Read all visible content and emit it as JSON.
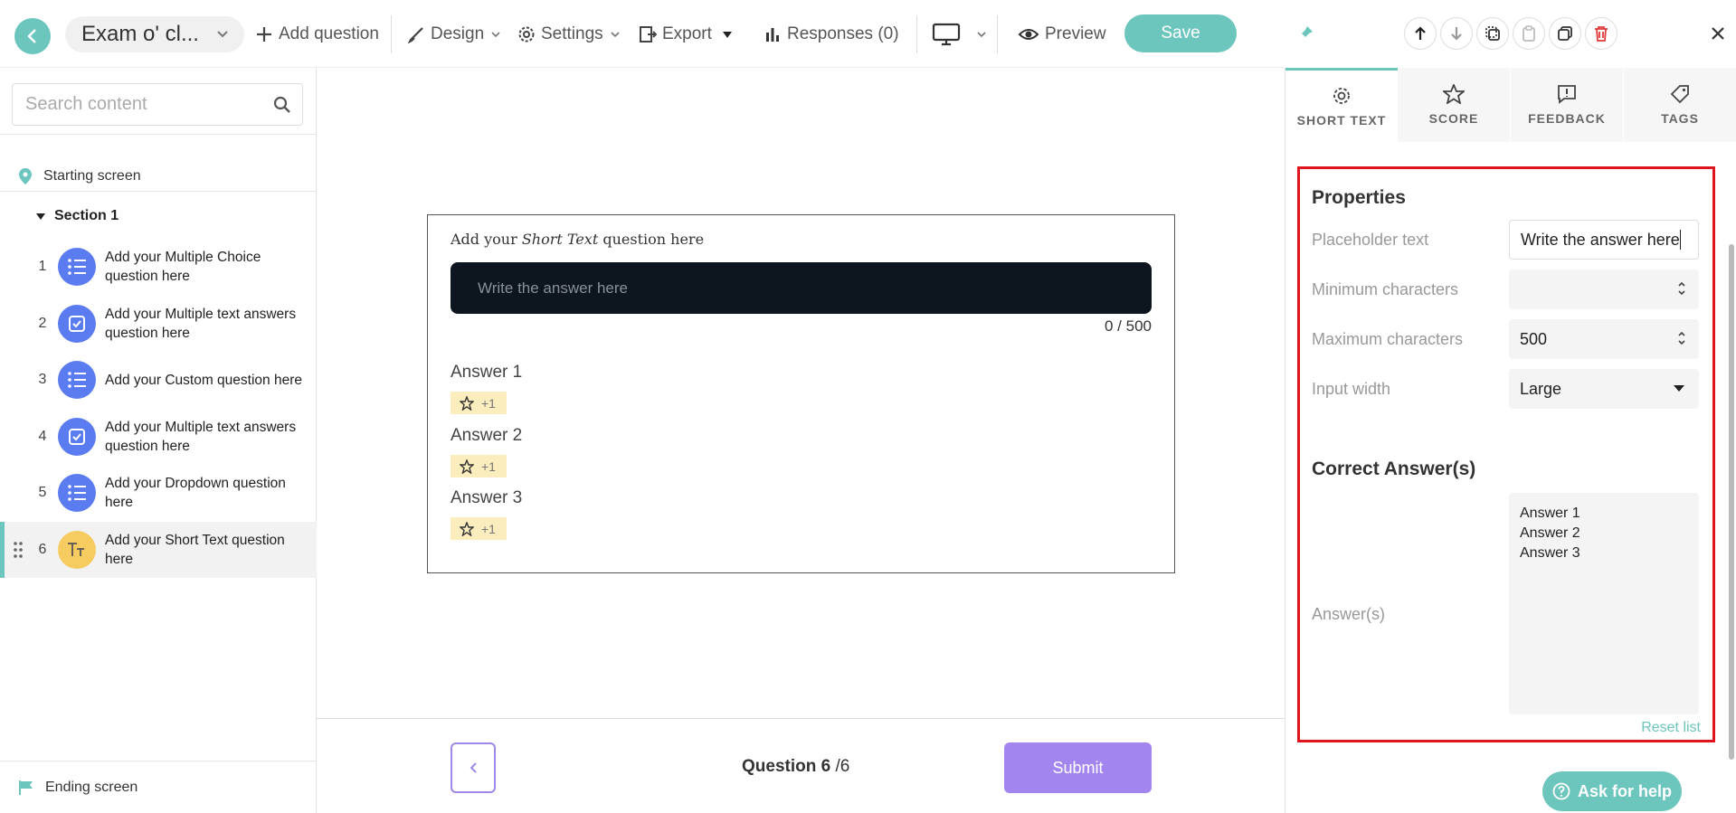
{
  "header": {
    "title": "Exam o' cl...",
    "add_question": "Add question",
    "design": "Design",
    "settings": "Settings",
    "export": "Export",
    "responses": "Responses (0)",
    "preview": "Preview",
    "save": "Save"
  },
  "sidebar": {
    "search_placeholder": "Search content",
    "starting_screen": "Starting screen",
    "section": "Section 1",
    "questions": [
      {
        "num": "1",
        "text": "Add your Multiple Choice question here",
        "icon": "list-icon"
      },
      {
        "num": "2",
        "text": "Add your Multiple text answers question here",
        "icon": "checkbox-icon"
      },
      {
        "num": "3",
        "text": "Add your Custom question here",
        "icon": "list-icon"
      },
      {
        "num": "4",
        "text": "Add your Multiple text answers question here",
        "icon": "checkbox-icon"
      },
      {
        "num": "5",
        "text": "Add your Dropdown question here",
        "icon": "list-icon"
      },
      {
        "num": "6",
        "text": "Add your Short Text question here",
        "icon": "text-type-icon"
      }
    ],
    "ending_screen": "Ending screen"
  },
  "canvas": {
    "question_prefix": "Add your ",
    "question_em": "Short Text",
    "question_suffix": " question here",
    "answer_placeholder": "Write the answer here",
    "counter": "0 / 500",
    "answers": [
      {
        "label": "Answer 1",
        "score": "+1"
      },
      {
        "label": "Answer 2",
        "score": "+1"
      },
      {
        "label": "Answer 3",
        "score": "+1"
      }
    ],
    "question_current": "Question 6",
    "question_total": " /6",
    "submit": "Submit"
  },
  "panel": {
    "tabs": [
      "SHORT TEXT",
      "SCORE",
      "FEEDBACK",
      "TAGS"
    ],
    "properties_title": "Properties",
    "placeholder_label": "Placeholder text",
    "placeholder_value": "Write the answer here",
    "min_label": "Minimum characters",
    "min_value": "",
    "max_label": "Maximum characters",
    "max_value": "500",
    "width_label": "Input width",
    "width_value": "Large",
    "correct_title": "Correct Answer(s)",
    "answers_label": "Answer(s)",
    "answers_value": "Answer 1\nAnswer 2\nAnswer 3",
    "reset": "Reset list",
    "help": "Ask for help"
  },
  "colors": {
    "accent": "#6cc6bd",
    "question_icon": "#5b7cf0",
    "short_text_icon": "#f6cc60",
    "submit": "#a385f0",
    "highlight": "#e0141e"
  }
}
